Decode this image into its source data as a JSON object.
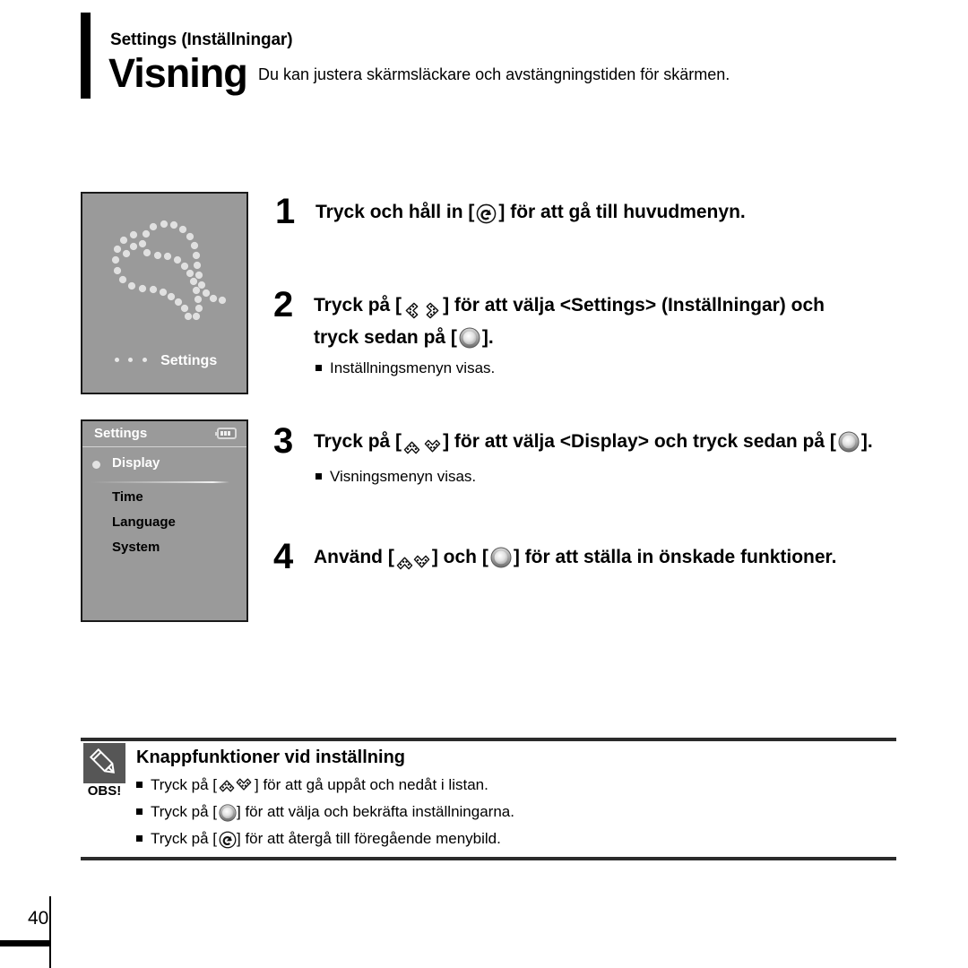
{
  "header": {
    "kicker": "Settings (Inställningar)",
    "title": "Visning",
    "description": "Du kan justera skärmsläckare och avstängningstiden för skärmen."
  },
  "screens": {
    "settings_icon_screen": {
      "icon_name": "wrench-dotted-icon",
      "label": "Settings"
    },
    "settings_menu_screen": {
      "title": "Settings",
      "battery_icon": "battery-icon",
      "battery_level": 3,
      "items": [
        {
          "label": "Display",
          "selected": true
        },
        {
          "label": "Time",
          "selected": false
        },
        {
          "label": "Language",
          "selected": false
        },
        {
          "label": "System",
          "selected": false
        }
      ]
    }
  },
  "steps": [
    {
      "number": "1",
      "text_before": "Tryck och håll in [",
      "icons": [
        "return-icon"
      ],
      "text_after": "] för att gå till huvudmenyn.",
      "note": ""
    },
    {
      "number": "2",
      "line1_before": "Tryck på [",
      "line1_icons": [
        "chevron-left-icon",
        "chevron-right-icon"
      ],
      "line1_after": "] för att välja <Settings> (Inställningar) och",
      "line2_before": "tryck sedan på [",
      "line2_icons": [
        "select-icon"
      ],
      "line2_after": "].",
      "note": "Inställningsmenyn visas."
    },
    {
      "number": "3",
      "text_before": "Tryck på [",
      "icons_a": [
        "chevron-up-icon",
        "chevron-down-icon"
      ],
      "text_middle": "] för att välja <Display> och tryck sedan på [",
      "icons_b": [
        "select-icon"
      ],
      "text_after": "].",
      "note": "Visningsmenyn visas."
    },
    {
      "number": "4",
      "text_before": "Använd [",
      "icons_a": [
        "chevron-up-icon",
        "chevron-down-icon"
      ],
      "text_middle": "] och [",
      "icons_b": [
        "select-icon"
      ],
      "text_after": "] för att ställa in önskade funktioner.",
      "note": ""
    }
  ],
  "note_box": {
    "icon_name": "pencil-icon",
    "icon_label": "OBS!",
    "title": "Knappfunktioner vid inställning",
    "lines": [
      {
        "before": "Tryck på  [",
        "icons": [
          "chevron-up-icon",
          "chevron-down-icon"
        ],
        "after": "] för att gå uppåt och nedåt i listan."
      },
      {
        "before": "Tryck på  [",
        "icons": [
          "select-icon"
        ],
        "after": "] för att välja och bekräfta inställningarna."
      },
      {
        "before": "Tryck på  [",
        "icons": [
          "return-icon"
        ],
        "after": "] för att återgå till föregående menybild."
      }
    ]
  },
  "footer": {
    "page_number": "40"
  },
  "colors": {
    "screen_bg": "#9a9a9a",
    "screen_border": "#1a1a1a",
    "note_icon_bg": "#565656",
    "rule": "#2b2b2b",
    "text": "#000000"
  }
}
